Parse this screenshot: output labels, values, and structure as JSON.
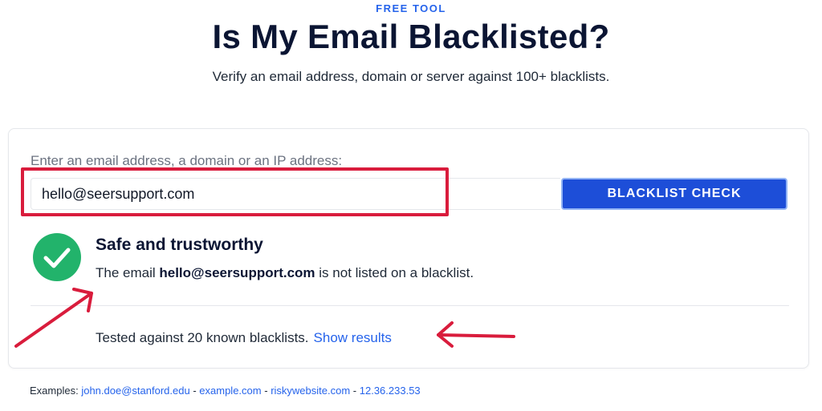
{
  "header": {
    "eyebrow": "FREE TOOL",
    "title": "Is My Email Blacklisted?",
    "subtitle": "Verify an email address, domain or server against 100+ blacklists."
  },
  "form": {
    "label": "Enter an email address, a domain or an IP address:",
    "input_value": "hello@seersupport.com",
    "button_label": "BLACKLIST CHECK"
  },
  "result": {
    "icon": "check-circle-icon",
    "title": "Safe and trustworthy",
    "message_prefix": "The email",
    "email": "hello@seersupport.com",
    "message_suffix": "is not listed on a blacklist.",
    "tested_text": "Tested against 20 known blacklists.",
    "show_results_label": "Show results"
  },
  "examples": {
    "label": "Examples:",
    "items": [
      "john.doe@stanford.edu",
      "example.com",
      "riskywebsite.com",
      "12.36.233.53"
    ],
    "separator": "-"
  },
  "colors": {
    "accent": "#2563eb",
    "button": "#1d4ed8",
    "success": "#22b36b",
    "annotation": "#d91c3c"
  }
}
